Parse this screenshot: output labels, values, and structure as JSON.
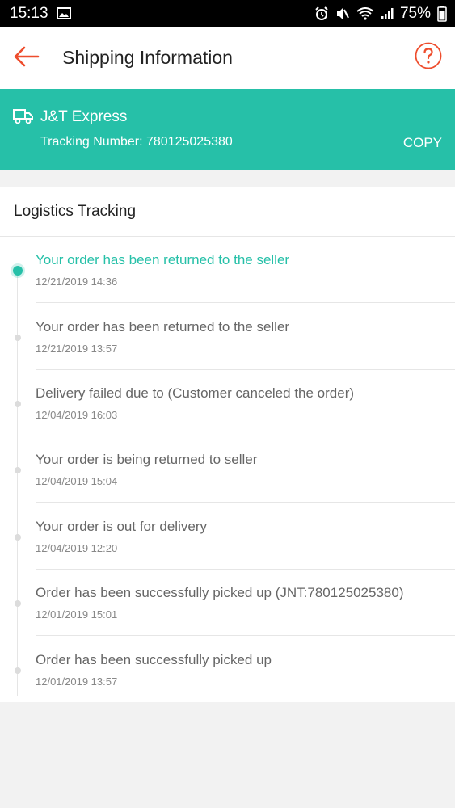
{
  "status_bar": {
    "time": "15:13",
    "battery": "75%"
  },
  "header": {
    "title": "Shipping Information",
    "back_icon": "back-arrow-icon",
    "help_icon": "question-circle-icon"
  },
  "carrier": {
    "name": "J&T Express",
    "tracking_label": "Tracking Number: 780125025380",
    "copy_label": "COPY",
    "color": "#26c0a8"
  },
  "logistics": {
    "heading": "Logistics Tracking",
    "events": [
      {
        "status": "Your order has been returned to the seller",
        "time": "12/21/2019 14:36",
        "active": true
      },
      {
        "status": "Your order has been returned to the seller",
        "time": "12/21/2019 13:57",
        "active": false
      },
      {
        "status": "Delivery failed due to (Customer canceled the order)",
        "time": "12/04/2019 16:03",
        "active": false
      },
      {
        "status": "Your order is being returned to seller",
        "time": "12/04/2019 15:04",
        "active": false
      },
      {
        "status": "Your order is out for delivery",
        "time": "12/04/2019 12:20",
        "active": false
      },
      {
        "status": "Order has been successfully picked up (JNT:780125025380)",
        "time": "12/01/2019 15:01",
        "active": false
      },
      {
        "status": "Order has been successfully picked up",
        "time": "12/01/2019 13:57",
        "active": false
      }
    ]
  },
  "accent_color": "#26c0a8",
  "back_color": "#ee4d2d"
}
